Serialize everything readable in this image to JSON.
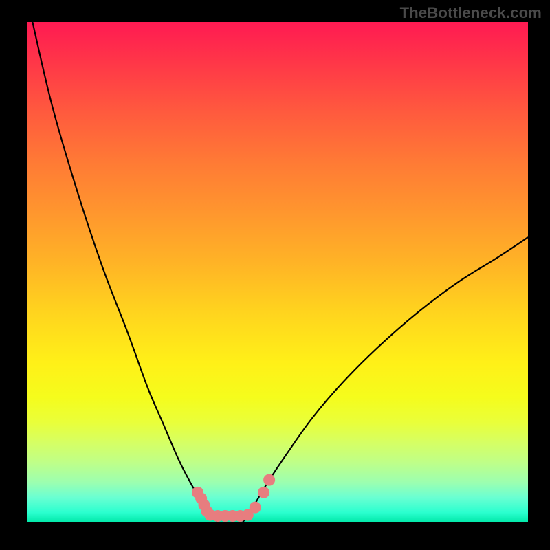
{
  "watermark": "TheBottleneck.com",
  "chart_data": {
    "type": "line",
    "title": "",
    "xlabel": "",
    "ylabel": "",
    "xlim": [
      0,
      100
    ],
    "ylim": [
      0,
      100
    ],
    "series": [
      {
        "name": "left-curve",
        "x": [
          1,
          5,
          10,
          15,
          20,
          24,
          27,
          30,
          32,
          34,
          35.5,
          37,
          38
        ],
        "y": [
          100,
          83,
          66,
          51,
          38,
          27,
          20,
          13,
          9,
          5.5,
          3.5,
          1.5,
          0
        ]
      },
      {
        "name": "right-curve",
        "x": [
          43,
          45,
          48,
          52,
          57,
          63,
          70,
          78,
          86,
          94,
          100
        ],
        "y": [
          0,
          3,
          8,
          14,
          21,
          28,
          35,
          42,
          48,
          53,
          57
        ]
      }
    ],
    "markers": [
      {
        "x": 34.0,
        "y": 6.0
      },
      {
        "x": 34.7,
        "y": 4.8
      },
      {
        "x": 35.3,
        "y": 3.5
      },
      {
        "x": 35.8,
        "y": 2.3
      },
      {
        "x": 36.5,
        "y": 1.5
      },
      {
        "x": 38.0,
        "y": 1.3
      },
      {
        "x": 39.5,
        "y": 1.3
      },
      {
        "x": 41.0,
        "y": 1.3
      },
      {
        "x": 42.5,
        "y": 1.3
      },
      {
        "x": 44.0,
        "y": 1.5
      },
      {
        "x": 45.5,
        "y": 3.0
      },
      {
        "x": 47.2,
        "y": 6.0
      },
      {
        "x": 48.3,
        "y": 8.5
      }
    ],
    "gradient_stops": [
      {
        "pct": 0,
        "color": "#ff1a52"
      },
      {
        "pct": 50,
        "color": "#ffd41e"
      },
      {
        "pct": 100,
        "color": "#00e8a8"
      }
    ]
  }
}
